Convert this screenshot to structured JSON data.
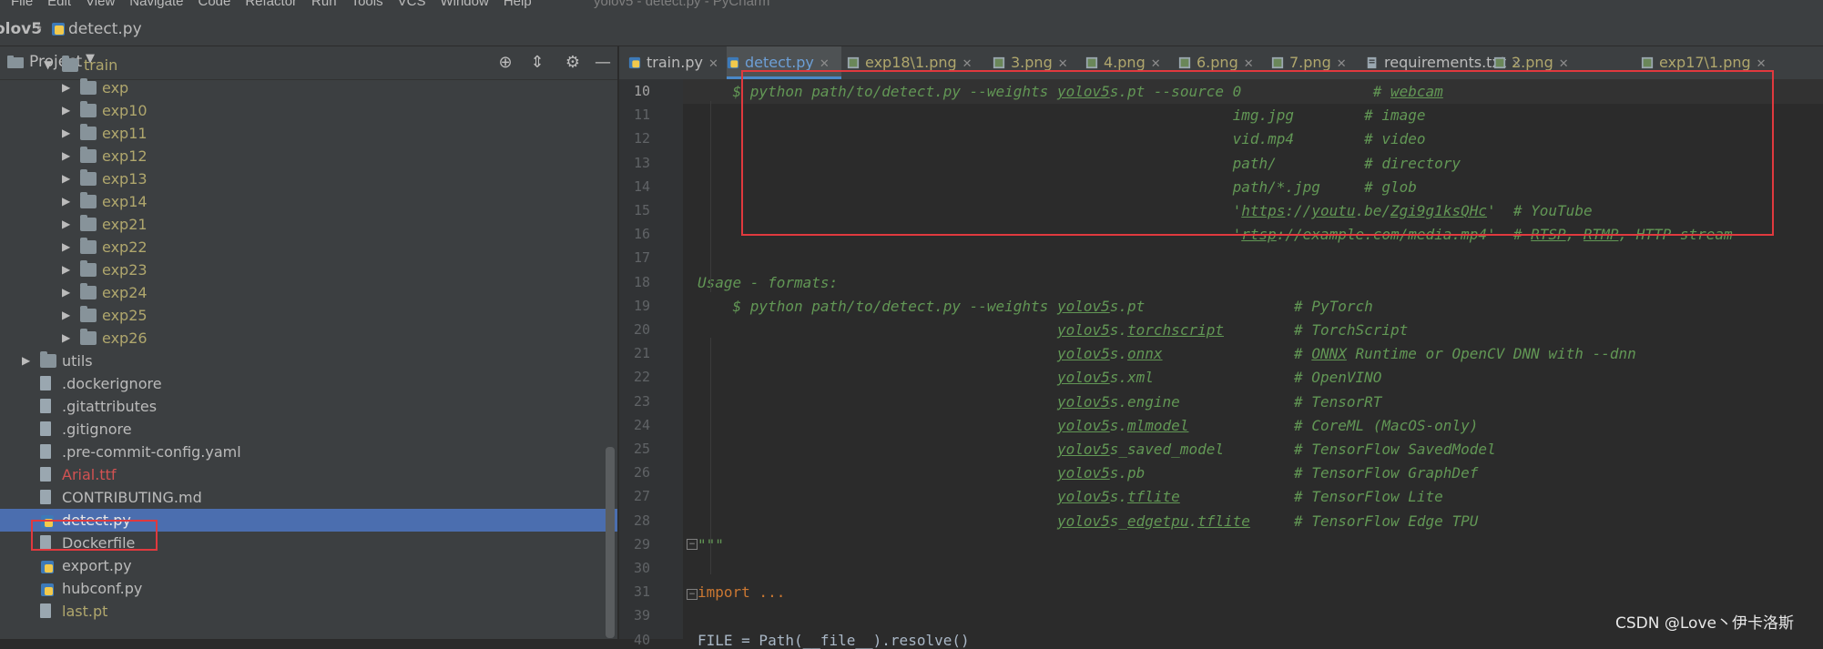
{
  "menubar": {
    "items": [
      "File",
      "Edit",
      "View",
      "Navigate",
      "Code",
      "Refactor",
      "Run",
      "Tools",
      "VCS",
      "Window",
      "Help"
    ],
    "window_title": "yolov5 - detect.py - PyCharm"
  },
  "navbar": {
    "project": "olov5",
    "file": "detect.py"
  },
  "project_panel": {
    "title": "Project",
    "tree": [
      {
        "label": "train",
        "color": "#b0a76d"
      },
      {
        "label": "exp",
        "color": "#b0a76d"
      },
      {
        "label": "exp10",
        "color": "#b0a76d"
      },
      {
        "label": "exp11",
        "color": "#b0a76d"
      },
      {
        "label": "exp12",
        "color": "#b0a76d"
      },
      {
        "label": "exp13",
        "color": "#b0a76d"
      },
      {
        "label": "exp14",
        "color": "#b0a76d"
      },
      {
        "label": "exp21",
        "color": "#b0a76d"
      },
      {
        "label": "exp22",
        "color": "#b0a76d"
      },
      {
        "label": "exp23",
        "color": "#b0a76d"
      },
      {
        "label": "exp24",
        "color": "#b0a76d"
      },
      {
        "label": "exp25",
        "color": "#b0a76d"
      },
      {
        "label": "exp26",
        "color": "#b0a76d"
      },
      {
        "label": "utils",
        "color": "#bbbbbb"
      },
      {
        "label": ".dockerignore",
        "color": "#bbbbbb"
      },
      {
        "label": ".gitattributes",
        "color": "#bbbbbb"
      },
      {
        "label": ".gitignore",
        "color": "#bbbbbb"
      },
      {
        "label": ".pre-commit-config.yaml",
        "color": "#bbbbbb"
      },
      {
        "label": "Arial.ttf",
        "color": "#d25252"
      },
      {
        "label": "CONTRIBUTING.md",
        "color": "#bbbbbb"
      },
      {
        "label": "detect.py",
        "color": "#e6e6e6"
      },
      {
        "label": "Dockerfile",
        "color": "#bbbbbb"
      },
      {
        "label": "export.py",
        "color": "#bbbbbb"
      },
      {
        "label": "hubconf.py",
        "color": "#bbbbbb"
      },
      {
        "label": "last.pt",
        "color": "#b0a76d"
      }
    ]
  },
  "tabs": [
    {
      "label": "train.py",
      "color": "#bbbbbb"
    },
    {
      "label": "detect.py",
      "color": "#6d9fd6"
    },
    {
      "label": "exp18\\1.png",
      "color": "#b0a76d"
    },
    {
      "label": "3.png",
      "color": "#b0a76d"
    },
    {
      "label": "4.png",
      "color": "#b0a76d"
    },
    {
      "label": "6.png",
      "color": "#b0a76d"
    },
    {
      "label": "7.png",
      "color": "#b0a76d"
    },
    {
      "label": "requirements.txt",
      "color": "#bbbbbb"
    },
    {
      "label": "2.png",
      "color": "#b0a76d"
    },
    {
      "label": "exp17\\1.png",
      "color": "#b0a76d"
    }
  ],
  "editor": {
    "line_numbers": [
      "10",
      "11",
      "12",
      "13",
      "14",
      "15",
      "16",
      "17",
      "18",
      "19",
      "20",
      "21",
      "22",
      "23",
      "24",
      "25",
      "26",
      "27",
      "28",
      "29",
      "30",
      "31",
      "39",
      "40"
    ],
    "code_lines": [
      "    $ python path/to/detect.py --weights yolov5s.pt --source 0               # webcam",
      "                                                             img.jpg        # image",
      "                                                             vid.mp4        # video",
      "                                                             path/          # directory",
      "                                                             path/*.jpg     # glob",
      "                                                             'https://youtu.be/Zgi9g1ksQHc'  # YouTube",
      "                                                             'rtsp://example.com/media.mp4'  # RTSP, RTMP, HTTP stream",
      "",
      "Usage - formats:",
      "    $ python path/to/detect.py --weights yolov5s.pt                 # PyTorch",
      "                                         yolov5s.torchscript        # TorchScript",
      "                                         yolov5s.onnx               # ONNX Runtime or OpenCV DNN with --dnn",
      "                                         yolov5s.xml                # OpenVINO",
      "                                         yolov5s.engine             # TensorRT",
      "                                         yolov5s.mlmodel            # CoreML (MacOS-only)",
      "                                         yolov5s_saved_model        # TensorFlow SavedModel",
      "                                         yolov5s.pb                 # TensorFlow GraphDef",
      "                                         yolov5s.tflite             # TensorFlow Lite",
      "                                         yolov5s_edgetpu.tflite     # TensorFlow Edge TPU",
      "\"\"\"",
      "",
      "import ...",
      "",
      "FILE = Path(__file__).resolve()"
    ]
  },
  "watermark": "CSDN @Love丶伊卡洛斯",
  "colors": {
    "accent": "#4b6eaf",
    "highlight": "#e0393e",
    "docstring": "#629755"
  }
}
